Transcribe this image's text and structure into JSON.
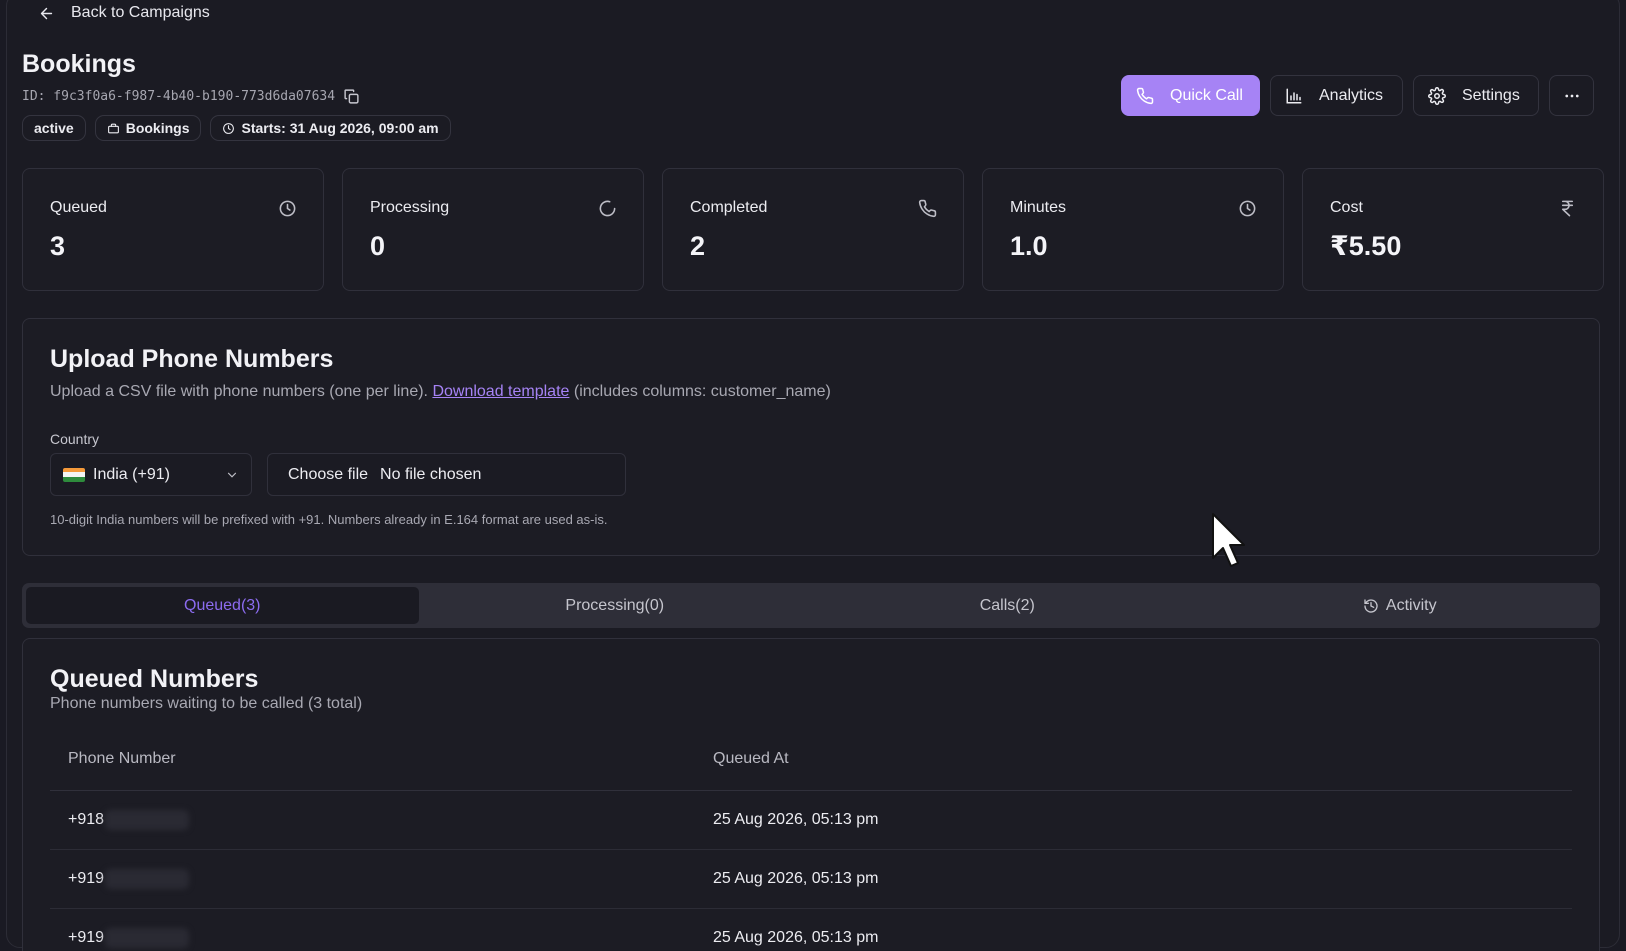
{
  "nav": {
    "back_label": "Back to Campaigns"
  },
  "campaign": {
    "title": "Bookings",
    "id_text": "ID: f9c3f0a6-f987-4b40-b190-773d6da07634",
    "badges": [
      "active",
      "Bookings",
      "Starts: 31 Aug 2026, 09:00 am"
    ]
  },
  "actions": {
    "quick_call": "Quick Call",
    "analytics": "Analytics",
    "settings": "Settings"
  },
  "stats": [
    {
      "label": "Queued",
      "value": "3",
      "icon": "clock-icon"
    },
    {
      "label": "Processing",
      "value": "0",
      "icon": "refresh-icon"
    },
    {
      "label": "Completed",
      "value": "2",
      "icon": "phone-icon"
    },
    {
      "label": "Minutes",
      "value": "1.0",
      "icon": "clock-icon"
    },
    {
      "label": "Cost",
      "value": "₹5.50",
      "icon": "rupee-icon"
    }
  ],
  "upload": {
    "title": "Upload Phone Numbers",
    "desc_prefix": "Upload a CSV file with phone numbers (one per line).",
    "template_link": "Download template",
    "desc_suffix": "(includes columns: customer_name)",
    "country_label": "Country",
    "country_value": "India (+91)",
    "file_button": "Choose file",
    "file_status": "No file chosen",
    "hint": "10-digit India numbers will be prefixed with +91. Numbers already in E.164 format are used as-is."
  },
  "tabs": [
    {
      "label": "Queued(3)"
    },
    {
      "label": "Processing(0)"
    },
    {
      "label": "Calls(2)"
    },
    {
      "label": "Activity"
    }
  ],
  "queued": {
    "title": "Queued Numbers",
    "subtitle": "Phone numbers waiting to be called (3 total)",
    "columns": [
      "Phone Number",
      "Queued At"
    ],
    "rows": [
      {
        "phone_prefix": "+918",
        "queued_at": "25 Aug 2026, 05:13 pm"
      },
      {
        "phone_prefix": "+919",
        "queued_at": "25 Aug 2026, 05:13 pm"
      },
      {
        "phone_prefix": "+919",
        "queued_at": "25 Aug 2026, 05:13 pm"
      }
    ]
  },
  "colors": {
    "accent": "#a683f5",
    "background": "#1a1a23",
    "card": "#1c1c24",
    "border": "#30303b"
  }
}
